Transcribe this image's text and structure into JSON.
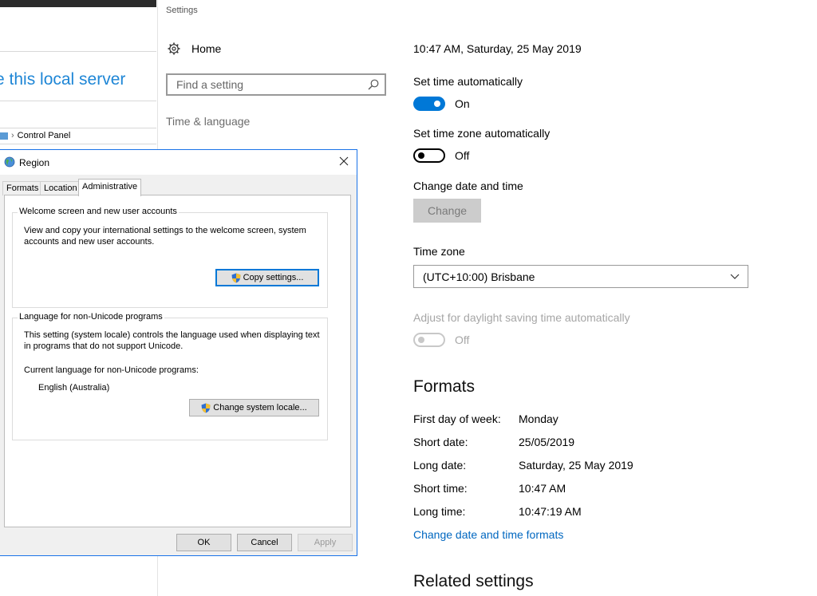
{
  "background_window": {
    "title": "e this local server",
    "breadcrumb": "Control Panel"
  },
  "settings": {
    "app_name": "Settings",
    "home_label": "Home",
    "search": {
      "placeholder": "Find a setting"
    },
    "category": "Time & language",
    "datetime_now": "10:47 AM, Saturday, 25 May 2019",
    "set_time_auto": {
      "label": "Set time automatically",
      "state": "On"
    },
    "set_tz_auto": {
      "label": "Set time zone automatically",
      "state": "Off"
    },
    "change_dt": {
      "label": "Change date and time",
      "button": "Change"
    },
    "time_zone": {
      "label": "Time zone",
      "value": "(UTC+10:00) Brisbane"
    },
    "dst": {
      "label": "Adjust for daylight saving time automatically",
      "state": "Off"
    },
    "formats": {
      "heading": "Formats",
      "rows": [
        {
          "label": "First day of week:",
          "value": "Monday"
        },
        {
          "label": "Short date:",
          "value": "25/05/2019"
        },
        {
          "label": "Long date:",
          "value": "Saturday, 25 May 2019"
        },
        {
          "label": "Short time:",
          "value": "10:47 AM"
        },
        {
          "label": "Long time:",
          "value": "10:47:19 AM"
        }
      ],
      "link": "Change date and time formats"
    },
    "related_heading": "Related settings",
    "colors": {
      "accent": "#0078d7",
      "link": "#0067c0"
    }
  },
  "region_dialog": {
    "title": "Region",
    "tabs": [
      "Formats",
      "Location",
      "Administrative"
    ],
    "active_tab": "Administrative",
    "welcome_group": {
      "label": "Welcome screen and new user accounts",
      "text": "View and copy your international settings to the welcome screen, system accounts and new user accounts.",
      "button": "Copy settings..."
    },
    "unicode_group": {
      "label": "Language for non-Unicode programs",
      "text": "This setting (system locale) controls the language used when displaying text in programs that do not support Unicode.",
      "current_label": "Current language for non-Unicode programs:",
      "current_value": "English (Australia)",
      "button": "Change system locale..."
    },
    "buttons": {
      "ok": "OK",
      "cancel": "Cancel",
      "apply": "Apply"
    }
  }
}
